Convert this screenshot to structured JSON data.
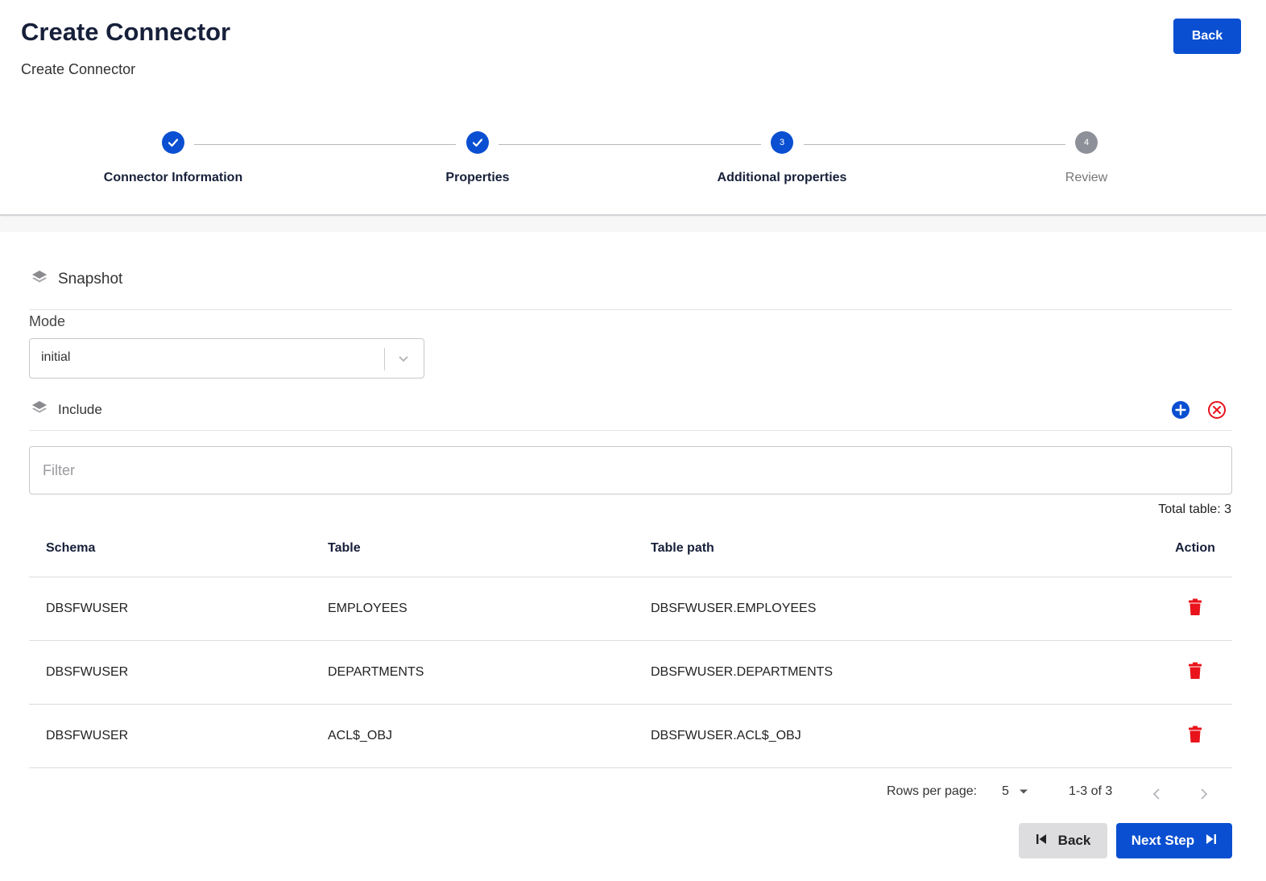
{
  "header": {
    "title": "Create Connector",
    "subtitle": "Create Connector",
    "back_label": "Back"
  },
  "stepper": {
    "steps": [
      {
        "label": "Connector Information",
        "state": "done",
        "number": "1"
      },
      {
        "label": "Properties",
        "state": "done",
        "number": "2"
      },
      {
        "label": "Additional properties",
        "state": "active",
        "number": "3"
      },
      {
        "label": "Review",
        "state": "pending",
        "number": "4"
      }
    ]
  },
  "snapshot": {
    "title": "Snapshot",
    "mode_label": "Mode",
    "mode_value": "initial"
  },
  "include": {
    "title": "Include",
    "filter_placeholder": "Filter",
    "total_text": "Total table: 3"
  },
  "table": {
    "headers": [
      "Schema",
      "Table",
      "Table path",
      "Action"
    ],
    "rows": [
      {
        "schema": "DBSFWUSER",
        "table": "EMPLOYEES",
        "path": "DBSFWUSER.EMPLOYEES"
      },
      {
        "schema": "DBSFWUSER",
        "table": "DEPARTMENTS",
        "path": "DBSFWUSER.DEPARTMENTS"
      },
      {
        "schema": "DBSFWUSER",
        "table": "ACL$_OBJ",
        "path": "DBSFWUSER.ACL$_OBJ"
      }
    ]
  },
  "pagination": {
    "rows_per_page_label": "Rows per page:",
    "rows_per_page_value": "5",
    "range_text": "1-3 of 3"
  },
  "footer": {
    "back_label": "Back",
    "next_label": "Next Step"
  },
  "colors": {
    "primary": "#0a4fd1",
    "danger": "#e8131b",
    "pending": "#8e9099"
  }
}
